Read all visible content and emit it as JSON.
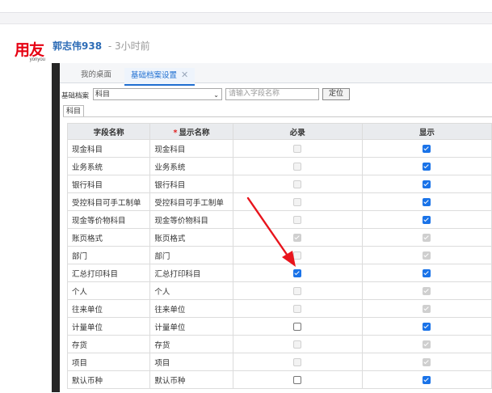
{
  "post": {
    "logo_text": "用友",
    "logo_sub": "yonyou",
    "author": "郭志伟938",
    "time": "- 3小时前"
  },
  "app": {
    "tabs": [
      "我的桌面",
      "基础档案设置"
    ],
    "close_glyph": "✕",
    "filter_label": "基础档案",
    "filter_value": "科目",
    "field_placeholder": "请输入字段名称",
    "locate_label": "定位",
    "subtab": "科目"
  },
  "grid": {
    "headers": [
      "字段名称",
      "显示名称",
      "必录",
      "显示"
    ],
    "required_mark": "*",
    "rows": [
      {
        "field": "现金科目",
        "display": "现金科目",
        "req_checked": false,
        "req_disabled": true,
        "show_checked": true,
        "show_disabled": false
      },
      {
        "field": "业务系统",
        "display": "业务系统",
        "req_checked": false,
        "req_disabled": true,
        "show_checked": true,
        "show_disabled": false
      },
      {
        "field": "银行科目",
        "display": "银行科目",
        "req_checked": false,
        "req_disabled": true,
        "show_checked": true,
        "show_disabled": false
      },
      {
        "field": "受控科目可手工制单",
        "display": "受控科目可手工制单",
        "req_checked": false,
        "req_disabled": true,
        "show_checked": true,
        "show_disabled": false
      },
      {
        "field": "现金等价物科目",
        "display": "现金等价物科目",
        "req_checked": false,
        "req_disabled": true,
        "show_checked": true,
        "show_disabled": false
      },
      {
        "field": "账页格式",
        "display": "账页格式",
        "req_checked": true,
        "req_disabled": true,
        "show_checked": true,
        "show_disabled": true
      },
      {
        "field": "部门",
        "display": "部门",
        "req_checked": false,
        "req_disabled": true,
        "show_checked": true,
        "show_disabled": true
      },
      {
        "field": "汇总打印科目",
        "display": "汇总打印科目",
        "req_checked": true,
        "req_disabled": false,
        "show_checked": true,
        "show_disabled": false
      },
      {
        "field": "个人",
        "display": "个人",
        "req_checked": false,
        "req_disabled": true,
        "show_checked": true,
        "show_disabled": true
      },
      {
        "field": "往来单位",
        "display": "往来单位",
        "req_checked": false,
        "req_disabled": true,
        "show_checked": true,
        "show_disabled": true
      },
      {
        "field": "计量单位",
        "display": "计量单位",
        "req_checked": false,
        "req_disabled": false,
        "show_checked": true,
        "show_disabled": false
      },
      {
        "field": "存货",
        "display": "存货",
        "req_checked": false,
        "req_disabled": true,
        "show_checked": true,
        "show_disabled": true
      },
      {
        "field": "项目",
        "display": "项目",
        "req_checked": false,
        "req_disabled": true,
        "show_checked": true,
        "show_disabled": true
      },
      {
        "field": "默认币种",
        "display": "默认币种",
        "req_checked": false,
        "req_disabled": false,
        "show_checked": true,
        "show_disabled": false
      }
    ]
  },
  "colors": {
    "accent": "#1f6fd1",
    "arrow": "#e8141c",
    "brand": "#e60012"
  }
}
